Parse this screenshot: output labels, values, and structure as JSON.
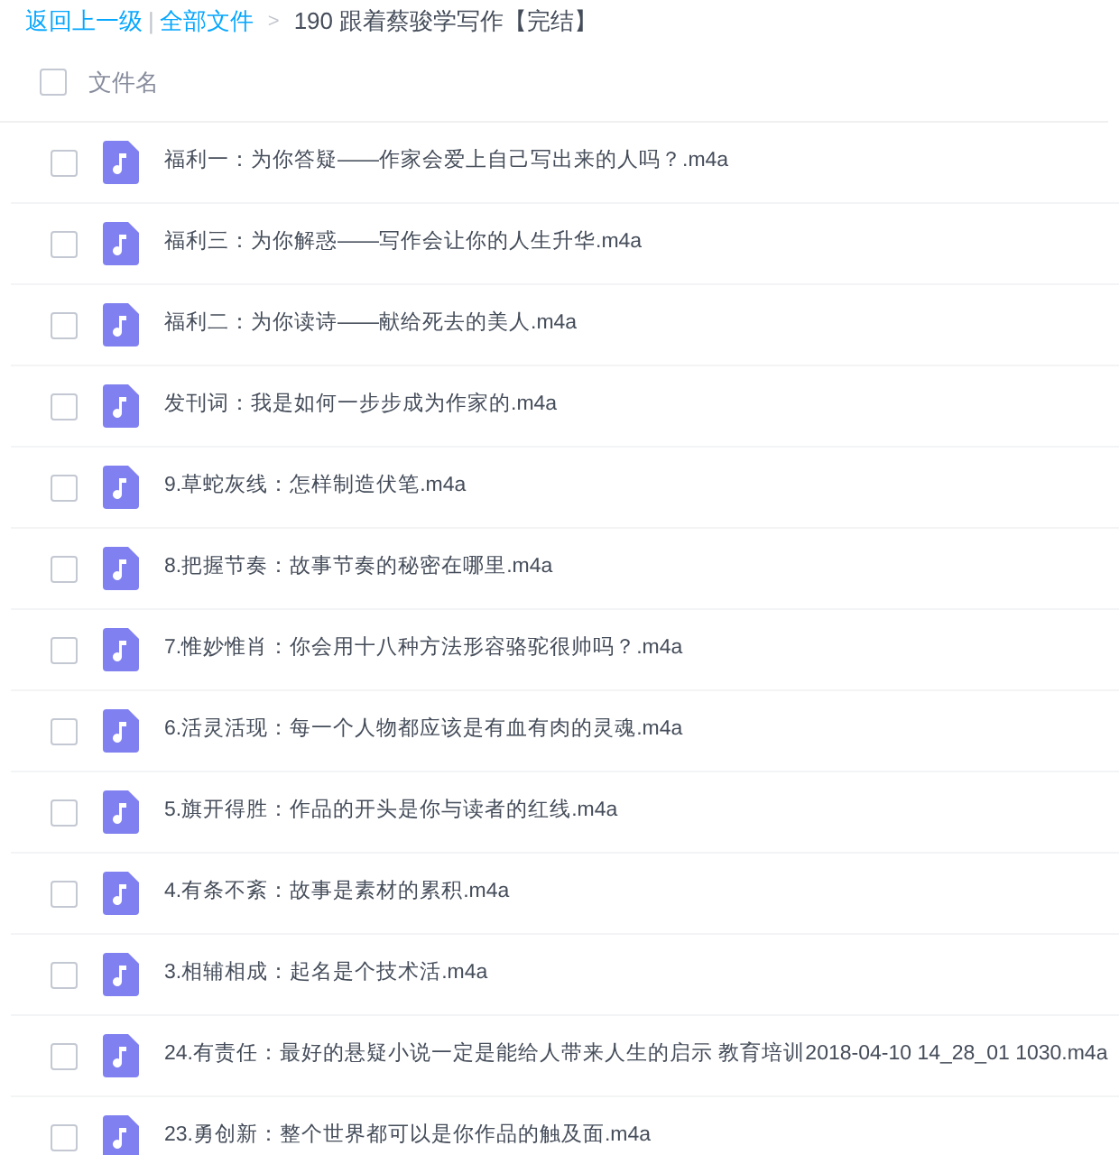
{
  "breadcrumb": {
    "back": "返回上一级",
    "separator": "|",
    "all_files": "全部文件",
    "arrow": ">",
    "current": "190 跟着蔡骏学写作【完结】"
  },
  "header": {
    "checked": false,
    "label": "文件名"
  },
  "files": [
    {
      "name": "福利一：为你答疑——作家会爱上自己写出来的人吗？.m4a",
      "checked": false
    },
    {
      "name": "福利三：为你解惑——写作会让你的人生升华.m4a",
      "checked": false
    },
    {
      "name": "福利二：为你读诗——献给死去的美人.m4a",
      "checked": false
    },
    {
      "name": "发刊词：我是如何一步步成为作家的.m4a",
      "checked": false
    },
    {
      "name": "9.草蛇灰线：怎样制造伏笔.m4a",
      "checked": false
    },
    {
      "name": "8.把握节奏：故事节奏的秘密在哪里.m4a",
      "checked": false
    },
    {
      "name": "7.惟妙惟肖：你会用十八种方法形容骆驼很帅吗？.m4a",
      "checked": false
    },
    {
      "name": "6.活灵活现：每一个人物都应该是有血有肉的灵魂.m4a",
      "checked": false
    },
    {
      "name": "5.旗开得胜：作品的开头是你与读者的红线.m4a",
      "checked": false
    },
    {
      "name": "4.有条不紊：故事是素材的累积.m4a",
      "checked": false
    },
    {
      "name": "3.相辅相成：起名是个技术活.m4a",
      "checked": false
    },
    {
      "name": "24.有责任：最好的悬疑小说一定是能给人带来人生的启示 教育培训2018-04-10 14_28_01 1030.m4a",
      "checked": false
    },
    {
      "name": "23.勇创新：整个世界都可以是你作品的触及面.m4a",
      "checked": false
    }
  ]
}
